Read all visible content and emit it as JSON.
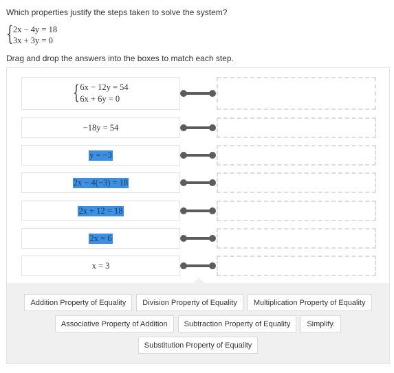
{
  "question": "Which properties justify the steps taken to solve the system?",
  "system": [
    "2x − 4y = 18",
    "3x + 3y = 0"
  ],
  "instruction": "Drag and drop the answers into the boxes to match each step.",
  "steps": [
    {
      "type": "system",
      "lines": [
        "6x − 12y = 54",
        "6x + 6y = 0"
      ],
      "highlighted": false,
      "drop_value": ""
    },
    {
      "type": "equation",
      "text": "−18y = 54",
      "highlighted": false,
      "drop_value": ""
    },
    {
      "type": "equation",
      "text": "y = −3",
      "highlighted": true,
      "drop_value": ""
    },
    {
      "type": "equation",
      "text": "2x − 4(−3) = 18",
      "highlighted": true,
      "drop_value": ""
    },
    {
      "type": "equation",
      "text": "2x + 12 = 18",
      "highlighted": true,
      "drop_value": ""
    },
    {
      "type": "equation",
      "text": "2x = 6",
      "highlighted": true,
      "drop_value": ""
    },
    {
      "type": "equation",
      "text": "x = 3",
      "highlighted": false,
      "drop_value": ""
    }
  ],
  "answers": [
    [
      "Addition Property of Equality",
      "Division Property of Equality",
      "Multiplication Property of Equality"
    ],
    [
      "Associative Property of Addition",
      "Subtraction Property of Equality",
      "Simplify."
    ],
    [
      "Substitution Property of Equality"
    ]
  ],
  "colors": {
    "highlight": "#3d8fe0",
    "connector": "#5c5c5c",
    "tray": "#f0f0f0",
    "dashed_border": "#dcdcdc"
  }
}
